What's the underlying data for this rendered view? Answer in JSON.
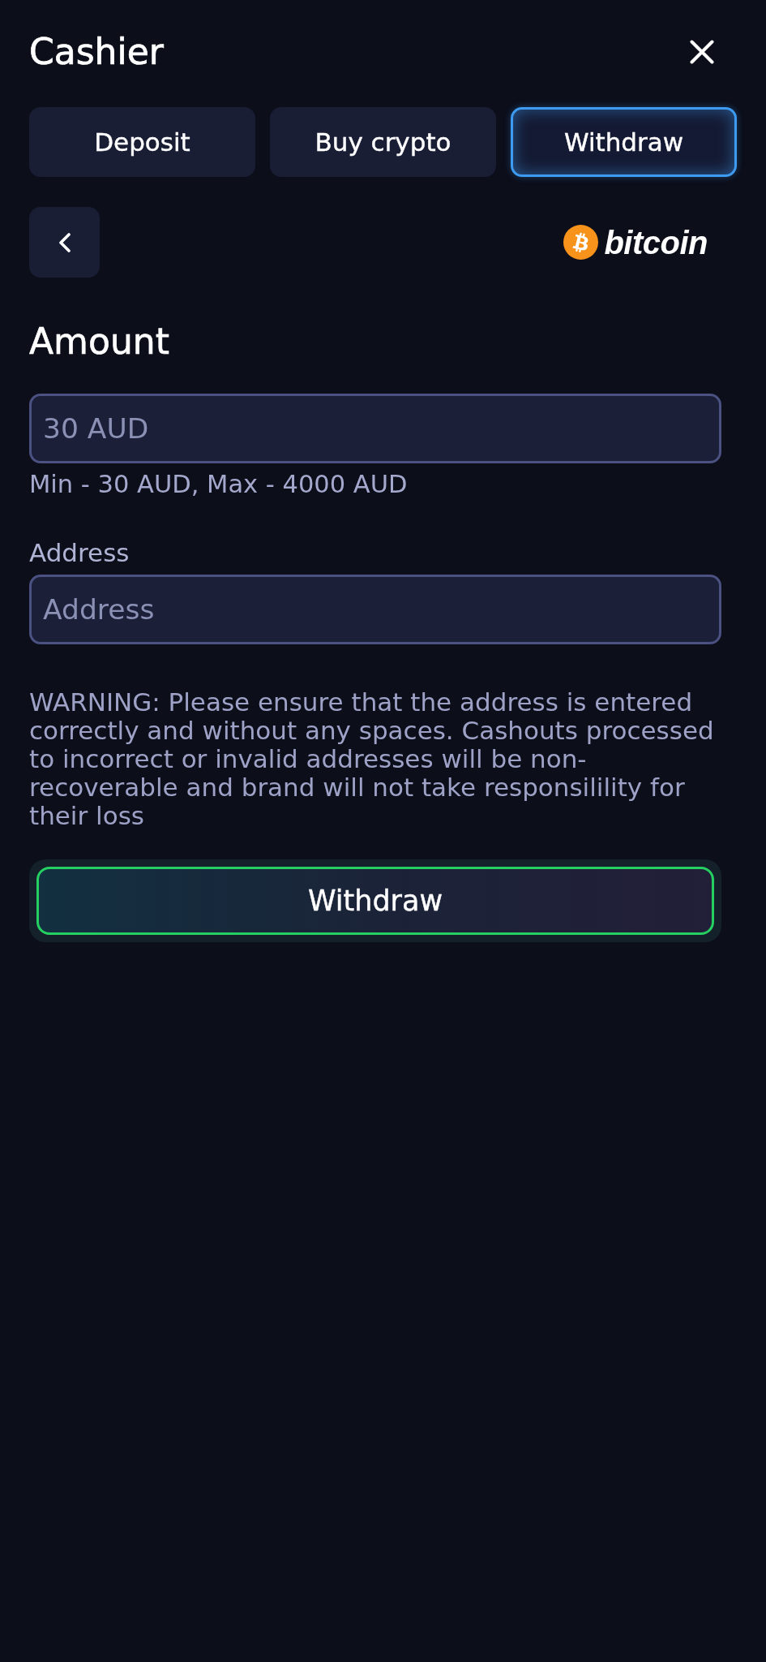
{
  "header": {
    "title": "Cashier"
  },
  "tabs": [
    {
      "label": "Deposit",
      "selected": false
    },
    {
      "label": "Buy crypto",
      "selected": false
    },
    {
      "label": "Withdraw",
      "selected": true
    }
  ],
  "method": {
    "name": "bitcoin"
  },
  "amount": {
    "heading": "Amount",
    "placeholder": "30 AUD",
    "hint": "Min - 30 AUD, Max - 4000 AUD"
  },
  "address": {
    "label": "Address",
    "placeholder": "Address"
  },
  "warning": "WARNING: Please ensure that the address is entered correctly and without any spaces. Cashouts processed to incorrect or invalid addresses will be non-recoverable and brand will not take responsilility for their loss",
  "submit_button": {
    "label": "Withdraw"
  }
}
